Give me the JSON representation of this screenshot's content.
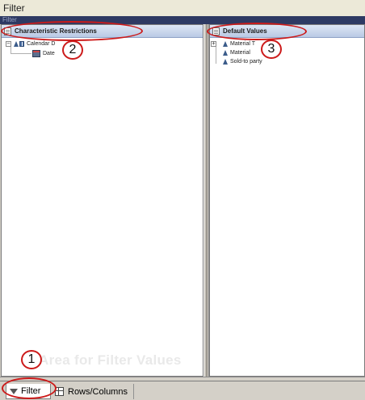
{
  "window": {
    "title": "Filter",
    "subbar_label": "Filter"
  },
  "left_pane": {
    "header": "Characteristic Restrictions",
    "tree": [
      {
        "label": "Calendar D",
        "expander": "−",
        "icon": "characteristic-icon"
      },
      {
        "label": "Date",
        "icon": "date-icon"
      }
    ],
    "drop_hint": "Area for Filter Values"
  },
  "right_pane": {
    "header": "Default Values",
    "tree": [
      {
        "label": "Material T",
        "expander": "+",
        "icon": "characteristic-icon"
      },
      {
        "label": "Material",
        "icon": "characteristic-icon"
      },
      {
        "label": "Sold-to party",
        "icon": "characteristic-icon"
      }
    ]
  },
  "tabs": [
    {
      "label": "Filter",
      "icon": "funnel-icon",
      "active": true
    },
    {
      "label": "Rows/Columns",
      "icon": "grid-icon",
      "active": false
    }
  ],
  "callouts": [
    "1",
    "2",
    "3"
  ],
  "colors": {
    "callout_red": "#cc1a1a",
    "header_blue": "#b9c9e4",
    "darkbar": "#2e3a63"
  }
}
